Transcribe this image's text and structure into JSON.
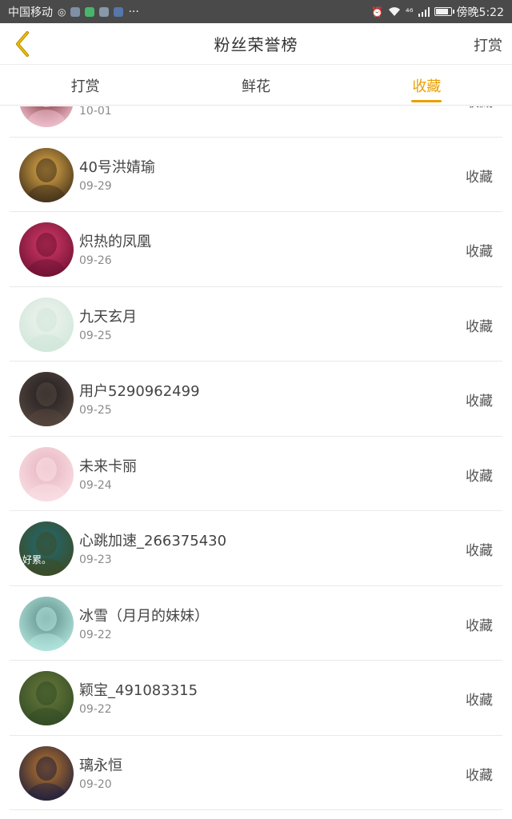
{
  "status_bar": {
    "carrier": "中国移动",
    "extra": "···",
    "time": "傍晚5:22",
    "signal": "⁴⁶",
    "battery_level": 0.85
  },
  "header": {
    "title": "粉丝荣誉榜",
    "action_label": "打赏"
  },
  "tabs": [
    {
      "label": "打赏",
      "active": false
    },
    {
      "label": "鲜花",
      "active": false
    },
    {
      "label": "收藏",
      "active": true
    }
  ],
  "list": [
    {
      "name": "",
      "date": "10-01",
      "action": "收藏",
      "avatar_colors": [
        "#f6c9d6",
        "#7a2b35"
      ]
    },
    {
      "name": "40号洪婧瑜",
      "date": "09-29",
      "action": "收藏",
      "avatar_colors": [
        "#3a2a18",
        "#e9b24a"
      ]
    },
    {
      "name": "炽热的凤凰",
      "date": "09-26",
      "action": "收藏",
      "avatar_colors": [
        "#6a1030",
        "#d83a6a"
      ]
    },
    {
      "name": "九天玄月",
      "date": "09-25",
      "action": "收藏",
      "avatar_colors": [
        "#cfe6d8",
        "#f0f4f1"
      ]
    },
    {
      "name": "用户5290962499",
      "date": "09-25",
      "action": "收藏",
      "avatar_colors": [
        "#5a4a40",
        "#1e1c20"
      ]
    },
    {
      "name": "未来卡丽",
      "date": "09-24",
      "action": "收藏",
      "avatar_colors": [
        "#fbe1e6",
        "#e6b3c0"
      ]
    },
    {
      "name": "心跳加速_266375430",
      "date": "09-23",
      "action": "收藏",
      "avatar_colors": [
        "#3e4a22",
        "#1f6a75"
      ]
    },
    {
      "name": "冰雪（月月的妹妹）",
      "date": "09-22",
      "action": "收藏",
      "avatar_colors": [
        "#b8ebe4",
        "#5c8c86"
      ]
    },
    {
      "name": "颖宝_491083315",
      "date": "09-22",
      "action": "收藏",
      "avatar_colors": [
        "#2f4a23",
        "#6b7a3c"
      ]
    },
    {
      "name": "璃永恒",
      "date": "09-20",
      "action": "收藏",
      "avatar_colors": [
        "#1a1c3e",
        "#c07a2a"
      ]
    }
  ],
  "avatar_texts": {
    "row6": "好累。"
  }
}
